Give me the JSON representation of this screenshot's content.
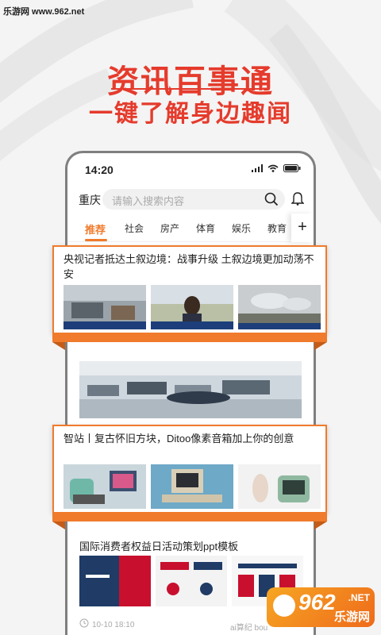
{
  "watermark": "乐游网 www.962.net",
  "headline": {
    "title": "资讯百事通",
    "subtitle": "一键了解身边趣闻"
  },
  "status_bar": {
    "time": "14:20"
  },
  "search": {
    "city": "重庆",
    "placeholder": "请输入搜索内容"
  },
  "tabs": [
    {
      "label": "推荐",
      "active": true
    },
    {
      "label": "社会"
    },
    {
      "label": "房产"
    },
    {
      "label": "体育"
    },
    {
      "label": "娱乐"
    },
    {
      "label": "教育"
    }
  ],
  "add_tab_label": "+",
  "featured": [
    {
      "title": "央视记者抵达土叙边境：战事升级 土叙边境更加动荡不安"
    },
    {
      "title": "智站丨复古怀旧方块，Ditoo像素音箱加上你的创意"
    }
  ],
  "feed": {
    "card4_title": "国际消费者权益日活动策划ppt模板",
    "card4_meta": "10-10 18:10",
    "card4_source": "ai算纪 bou"
  },
  "logo": {
    "num": "962",
    "net": ".NET",
    "cn": "乐游网"
  },
  "colors": {
    "accent": "#e53b2c",
    "tab_active": "#f07b2c"
  }
}
